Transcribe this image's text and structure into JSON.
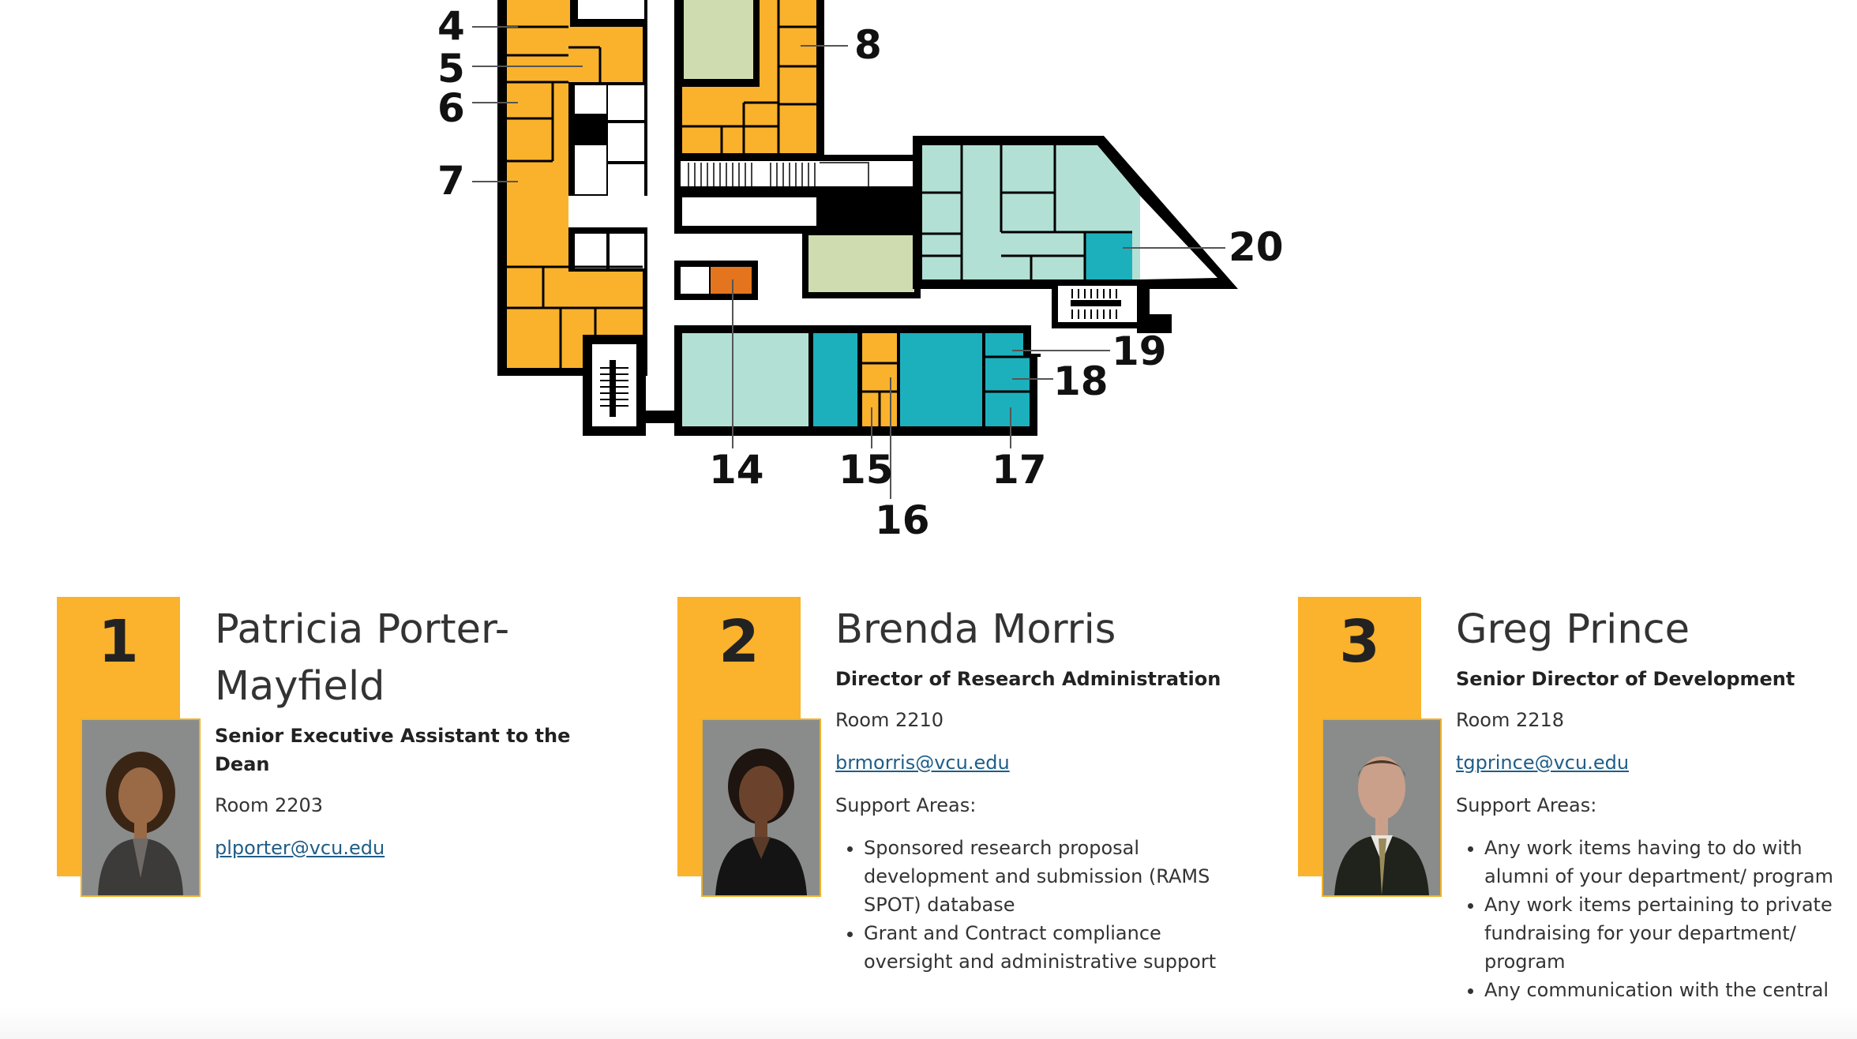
{
  "colors": {
    "accent_yellow": "#fbb22c",
    "room_orange": "#fab22c",
    "room_teal": "#1cb0bd",
    "room_mint": "#b3e0d5",
    "room_sage": "#cfdcb0",
    "room_dark_orange": "#e4751e",
    "wall": "#000000",
    "link": "#1f5d88"
  },
  "floorplan": {
    "labels": [
      "4",
      "5",
      "6",
      "7",
      "8",
      "20",
      "19",
      "18",
      "14",
      "15",
      "17",
      "16"
    ]
  },
  "staff": [
    {
      "number": "1",
      "name": "Patricia Porter-Mayfield",
      "title": "Senior Executive Assistant to the Dean",
      "room": "Room 2203",
      "email": "plporter@vcu.edu"
    },
    {
      "number": "2",
      "name": "Brenda Morris",
      "title": "Director of Research Administration",
      "room": "Room 2210",
      "email": "brmorris@vcu.edu",
      "support_label": "Support Areas:",
      "support_areas": [
        "Sponsored research proposal development and submission (RAMS SPOT) database",
        "Grant and Contract compliance oversight and administrative support"
      ]
    },
    {
      "number": "3",
      "name": "Greg Prince",
      "title": "Senior Director of Development",
      "room": "Room 2218",
      "email": "tgprince@vcu.edu",
      "support_label": "Support Areas:",
      "support_areas": [
        "Any work items having to do with alumni of your department/ program",
        "Any work items pertaining to private fundraising for your department/ program",
        "Any communication with the central"
      ]
    }
  ]
}
